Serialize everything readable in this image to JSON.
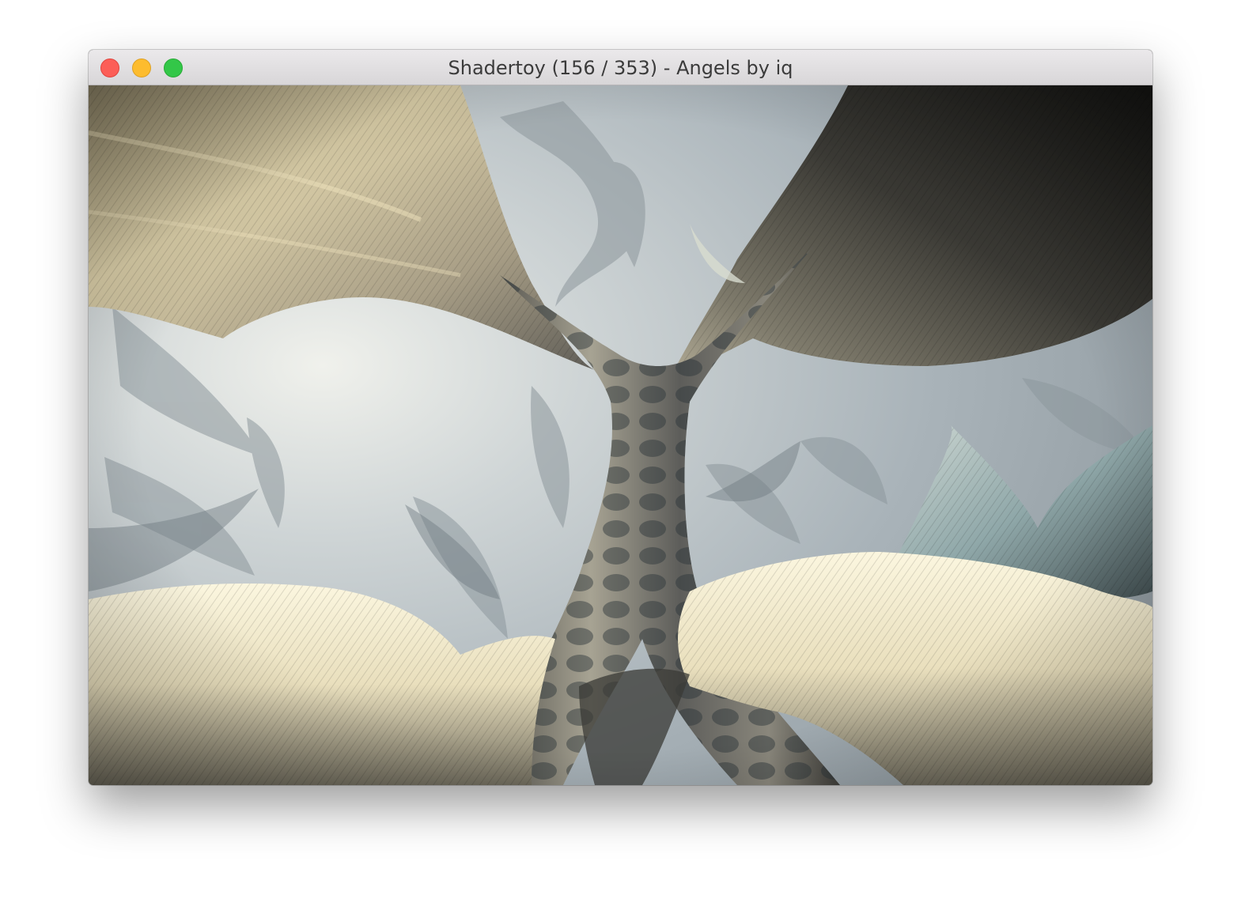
{
  "window": {
    "title": "Shadertoy (156 / 353) - Angels by iq"
  },
  "titlebar_buttons": [
    {
      "name": "close",
      "color": "#fc5e57"
    },
    {
      "name": "minimize",
      "color": "#fdbc2e"
    },
    {
      "name": "maximize",
      "color": "#33c748"
    }
  ],
  "scene": {
    "sky_color": "#b4bfc6",
    "glow_color": "#eef0ea",
    "wing_warm": "#d7cba8",
    "wing_dark": "#2c2c28",
    "wing_cream": "#f3ecd0",
    "trunk_color": "#6d6c66"
  }
}
